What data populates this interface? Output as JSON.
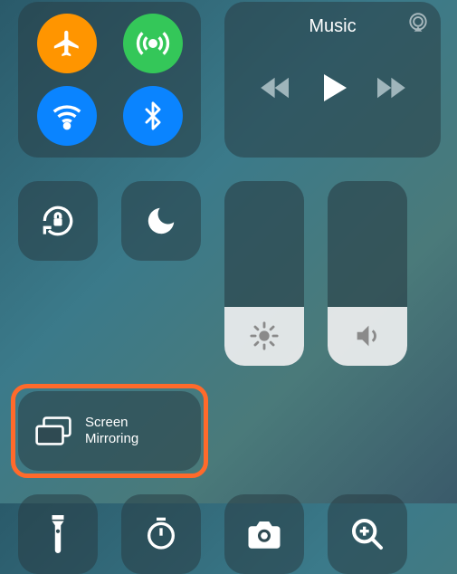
{
  "connectivity": {
    "airplane": "airplane-icon",
    "cellular": "cellular-icon",
    "wifi": "wifi-icon",
    "bluetooth": "bluetooth-icon"
  },
  "music": {
    "title": "Music",
    "airplay": "airplay-icon",
    "prev": "previous-track-icon",
    "play": "play-icon",
    "next": "next-track-icon"
  },
  "row2": {
    "lock": "orientation-lock-icon",
    "dnd": "do-not-disturb-icon"
  },
  "mirror": {
    "label": "Screen\nMirroring",
    "icon": "screen-mirroring-icon"
  },
  "sliders": {
    "brightness": {
      "level_pct": 32,
      "icon": "brightness-icon"
    },
    "volume": {
      "level_pct": 32,
      "icon": "volume-icon"
    }
  },
  "row4": {
    "flashlight": "flashlight-icon",
    "timer": "timer-icon",
    "camera": "camera-icon",
    "magnifier": "magnifier-icon"
  },
  "colors": {
    "highlight": "#ff6a2b",
    "orange": "#ff9500",
    "green": "#34c759",
    "blue": "#0a84ff"
  }
}
